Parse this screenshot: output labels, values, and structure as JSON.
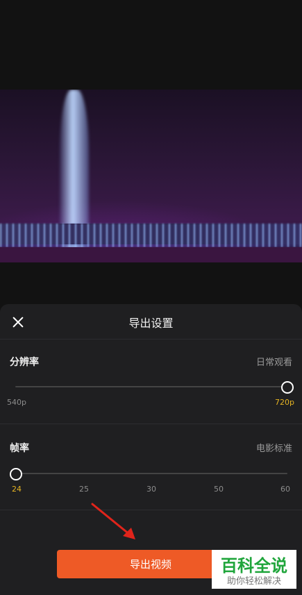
{
  "dialog": {
    "title": "导出设置"
  },
  "resolution": {
    "label": "分辨率",
    "hint": "日常观看",
    "min_label": "540p",
    "max_label": "720p",
    "selected": "720p",
    "selected_fraction": 1.0
  },
  "framerate": {
    "label": "帧率",
    "hint": "电影标准",
    "options": [
      "24",
      "25",
      "30",
      "50",
      "60"
    ],
    "selected": "24",
    "selected_fraction": 0.0
  },
  "export_button": {
    "label": "导出视频"
  },
  "watermark": {
    "main": "百科全说",
    "sub": "助你轻松解决"
  },
  "colors": {
    "accent": "#ee5a26",
    "selected_tick": "#e6b422",
    "sheet_bg": "#1f1f21"
  }
}
